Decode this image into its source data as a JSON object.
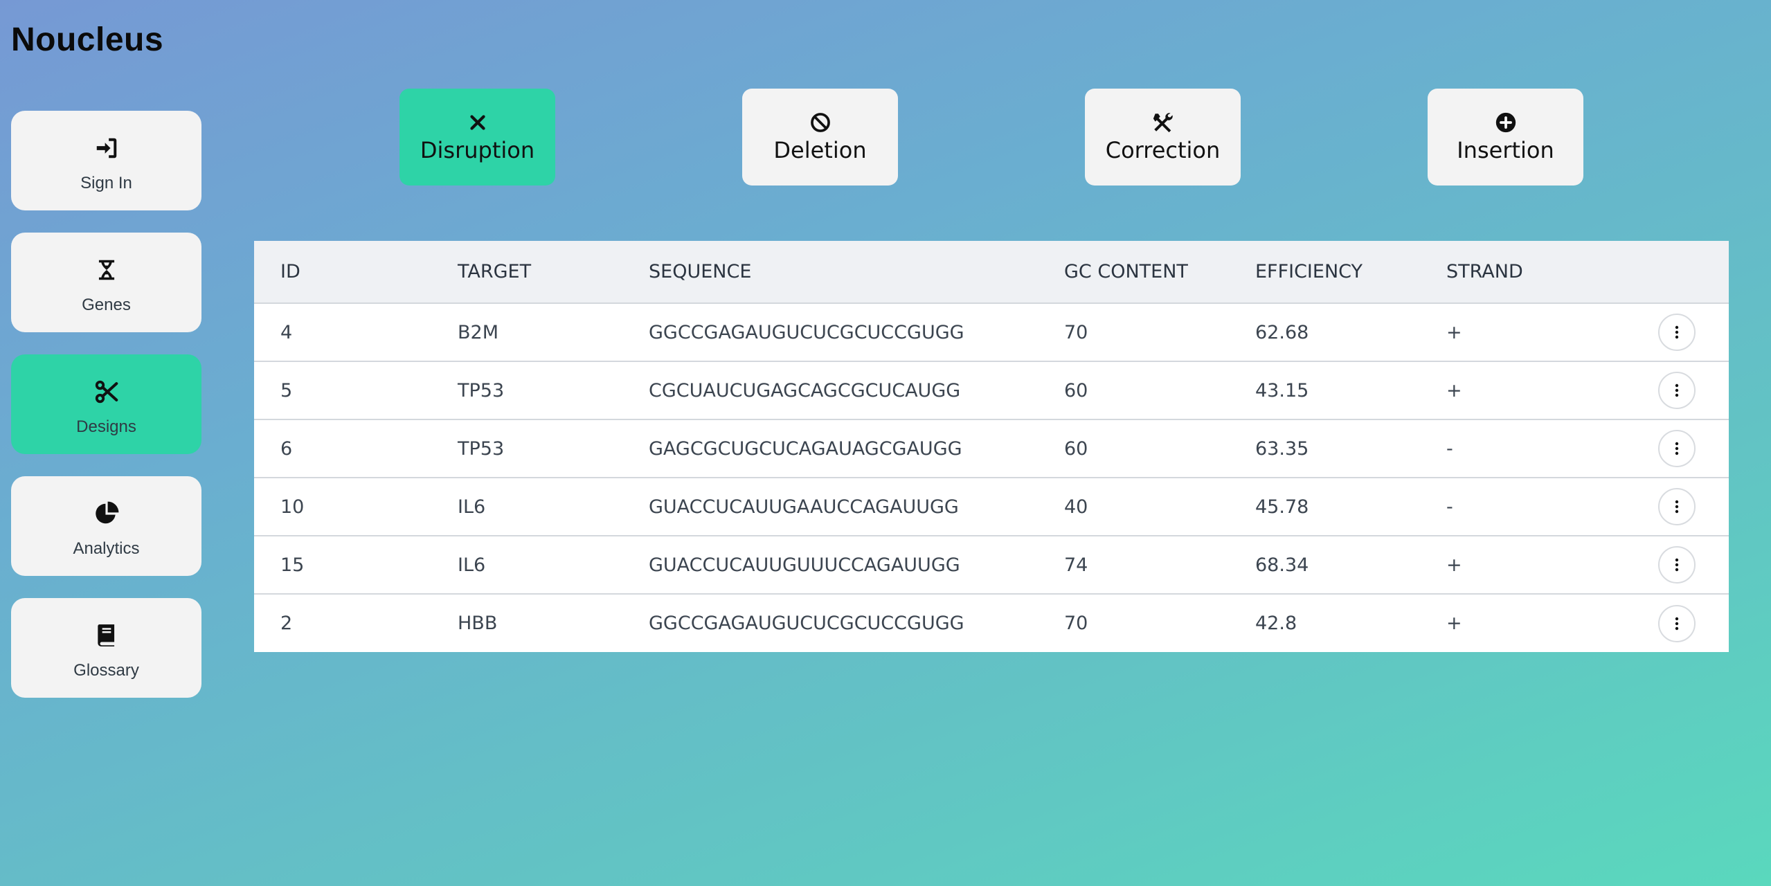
{
  "app": {
    "title": "Noucleus"
  },
  "sidebar": {
    "items": [
      {
        "label": "Sign In",
        "icon": "sign-in-icon",
        "active": false
      },
      {
        "label": "Genes",
        "icon": "dna-icon",
        "active": false
      },
      {
        "label": "Designs",
        "icon": "scissors-icon",
        "active": true
      },
      {
        "label": "Analytics",
        "icon": "pie-chart-icon",
        "active": false
      },
      {
        "label": "Glossary",
        "icon": "book-icon",
        "active": false
      }
    ]
  },
  "modes": [
    {
      "label": "Disruption",
      "icon": "x-icon",
      "active": true
    },
    {
      "label": "Deletion",
      "icon": "ban-icon",
      "active": false
    },
    {
      "label": "Correction",
      "icon": "tools-icon",
      "active": false
    },
    {
      "label": "Insertion",
      "icon": "plus-circle-icon",
      "active": false
    }
  ],
  "table": {
    "headers": [
      "ID",
      "TARGET",
      "SEQUENCE",
      "GC CONTENT",
      "EFFICIENCY",
      "STRAND"
    ],
    "rows": [
      {
        "id": "4",
        "target": "B2M",
        "sequence": "GGCCGAGAUGUCUCGCUCCGUGG",
        "gc": "70",
        "efficiency": "62.68",
        "strand": "+"
      },
      {
        "id": "5",
        "target": "TP53",
        "sequence": "CGCUAUCUGAGCAGCGCUCAUGG",
        "gc": "60",
        "efficiency": "43.15",
        "strand": "+"
      },
      {
        "id": "6",
        "target": "TP53",
        "sequence": "GAGCGCUGCUCAGAUAGCGAUGG",
        "gc": "60",
        "efficiency": "63.35",
        "strand": "-"
      },
      {
        "id": "10",
        "target": "IL6",
        "sequence": "GUACCUCAUUGAAUCCAGAUUGG",
        "gc": "40",
        "efficiency": "45.78",
        "strand": "-"
      },
      {
        "id": "15",
        "target": "IL6",
        "sequence": "GUACCUCAUUGUUUCCAGAUUGG",
        "gc": "74",
        "efficiency": "68.34",
        "strand": "+"
      },
      {
        "id": "2",
        "target": "HBB",
        "sequence": "GGCCGAGAUGUCUCGCUCCGUGG",
        "gc": "70",
        "efficiency": "42.8",
        "strand": "+"
      }
    ]
  },
  "colors": {
    "accent": "#2ed3a7",
    "card": "#f3f3f3",
    "header_row": "#eff1f4"
  }
}
